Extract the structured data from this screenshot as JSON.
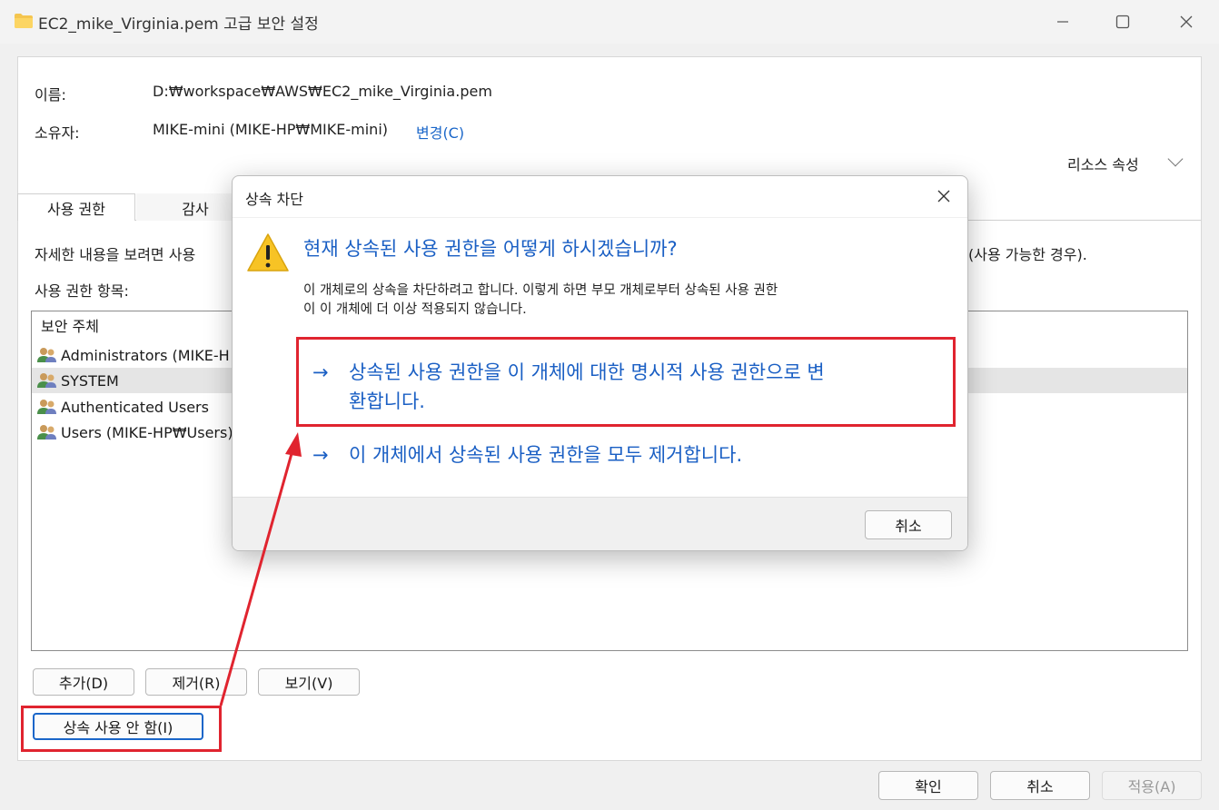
{
  "window": {
    "title": "EC2_mike_Virginia.pem 고급 보안 설정",
    "icons": {
      "folder": "folder-icon",
      "minimize": "minimize-icon",
      "maximize": "maximize-icon",
      "close": "close-icon"
    }
  },
  "info": {
    "name_label": "이름:",
    "name_value": "D:₩workspace₩AWS₩EC2_mike_Virginia.pem",
    "owner_label": "소유자:",
    "owner_value": "MIKE-mini (MIKE-HP₩MIKE-mini)",
    "owner_change": "변경(C)",
    "resource_props": "리소스 속성"
  },
  "tabs": [
    {
      "label": "사용 권한",
      "active": true
    },
    {
      "label": "감사",
      "active": false
    }
  ],
  "permissions": {
    "help_text_left": "자세한 내용을 보려면 사용",
    "help_text_right": "(사용 가능한 경우).",
    "entries_label": "사용 권한 항목:",
    "column_principal": "보안 주체",
    "rows": [
      {
        "principal": "Administrators (MIKE-H",
        "selected": false
      },
      {
        "principal": "SYSTEM",
        "selected": true
      },
      {
        "principal": "Authenticated Users",
        "selected": false
      },
      {
        "principal": "Users (MIKE-HP₩Users)",
        "selected": false
      }
    ]
  },
  "actions": {
    "add": "추가(D)",
    "remove": "제거(R)",
    "view": "보기(V)",
    "disable_inheritance": "상속 사용 안 함(I)"
  },
  "footer": {
    "ok": "확인",
    "cancel": "취소",
    "apply": "적용(A)"
  },
  "dialog": {
    "title": "상속 차단",
    "question": "현재 상속된 사용 권한을 어떻게 하시겠습니까?",
    "description_line1": "이 개체로의 상속을 차단하려고 합니다. 이렇게 하면 부모 개체로부터 상속된 사용 권한",
    "description_line2": "이 이 개체에 더 이상 적용되지 않습니다.",
    "option_convert_line1": "상속된 사용 권한을 이 개체에 대한 명시적 사용 권한으로 변",
    "option_convert_line2": "환합니다.",
    "option_remove": "이 개체에서 상속된 사용 권한을 모두 제거합니다.",
    "cancel": "취소",
    "arrow_glyph": "→",
    "icons": {
      "warning": "warning-icon",
      "close": "close-icon"
    }
  },
  "annotations": {
    "highlight_color": "#e0242f",
    "arrow_color": "#e0242f"
  },
  "colors": {
    "accent": "#1a66c9",
    "dialog_link": "#1a5fc4"
  }
}
